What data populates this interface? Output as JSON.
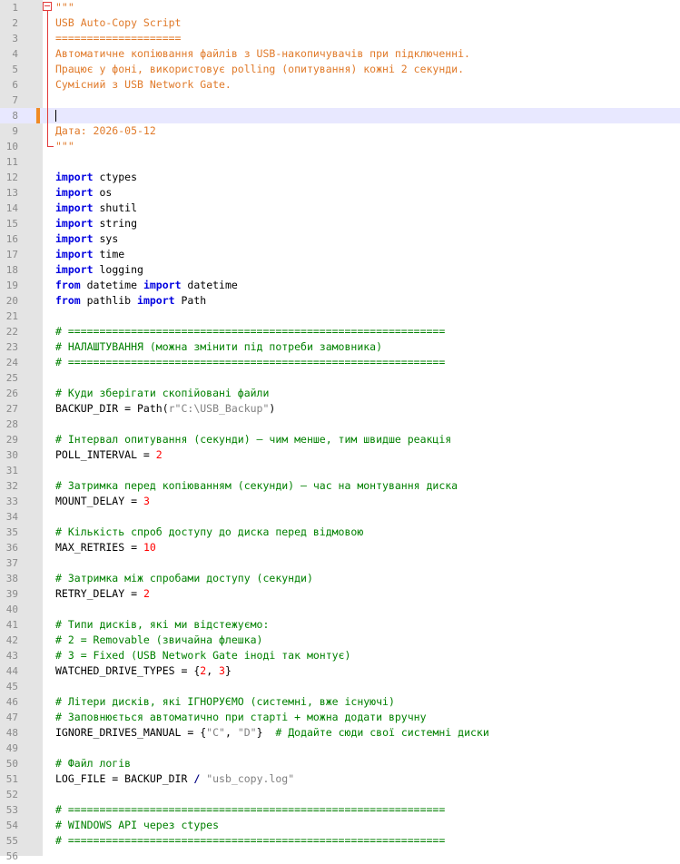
{
  "editor": {
    "current_line": 8,
    "changed_line": 8,
    "fold": {
      "start": 1,
      "end": 10
    },
    "colors": {
      "docstring": "#e07a2a",
      "keyword": "#0000e0",
      "comment": "#008000",
      "number": "#ff0000",
      "string": "#808080",
      "operator": "#000080",
      "gutter_bg": "#e4e4e4",
      "current_line_bg": "#e8e8ff",
      "fold_marker": "#e23a3a"
    },
    "lines": [
      {
        "n": "1",
        "tokens": [
          {
            "t": "\"\"\"",
            "c": "doc"
          }
        ]
      },
      {
        "n": "2",
        "tokens": [
          {
            "t": "USB Auto-Copy Script",
            "c": "doc"
          }
        ]
      },
      {
        "n": "3",
        "tokens": [
          {
            "t": "====================",
            "c": "doc"
          }
        ]
      },
      {
        "n": "4",
        "tokens": [
          {
            "t": "Автоматичне копіювання файлів з USB-накопичувачів при підключенні.",
            "c": "doc"
          }
        ]
      },
      {
        "n": "5",
        "tokens": [
          {
            "t": "Працює у фоні, використовує polling (опитування) кожні 2 секунди.",
            "c": "doc"
          }
        ]
      },
      {
        "n": "6",
        "tokens": [
          {
            "t": "Сумісний з USB Network Gate.",
            "c": "doc"
          }
        ]
      },
      {
        "n": "7",
        "tokens": []
      },
      {
        "n": "8",
        "tokens": []
      },
      {
        "n": "9",
        "tokens": [
          {
            "t": "Дата: 2026-05-12",
            "c": "doc"
          }
        ]
      },
      {
        "n": "10",
        "tokens": [
          {
            "t": "\"\"\"",
            "c": "doc"
          }
        ]
      },
      {
        "n": "11",
        "tokens": []
      },
      {
        "n": "12",
        "tokens": [
          {
            "t": "import",
            "c": "kw"
          },
          {
            "t": " ctypes",
            "c": "plain"
          }
        ]
      },
      {
        "n": "13",
        "tokens": [
          {
            "t": "import",
            "c": "kw"
          },
          {
            "t": " os",
            "c": "plain"
          }
        ]
      },
      {
        "n": "14",
        "tokens": [
          {
            "t": "import",
            "c": "kw"
          },
          {
            "t": " shutil",
            "c": "plain"
          }
        ]
      },
      {
        "n": "15",
        "tokens": [
          {
            "t": "import",
            "c": "kw"
          },
          {
            "t": " string",
            "c": "plain"
          }
        ]
      },
      {
        "n": "16",
        "tokens": [
          {
            "t": "import",
            "c": "kw"
          },
          {
            "t": " sys",
            "c": "plain"
          }
        ]
      },
      {
        "n": "17",
        "tokens": [
          {
            "t": "import",
            "c": "kw"
          },
          {
            "t": " time",
            "c": "plain"
          }
        ]
      },
      {
        "n": "18",
        "tokens": [
          {
            "t": "import",
            "c": "kw"
          },
          {
            "t": " logging",
            "c": "plain"
          }
        ]
      },
      {
        "n": "19",
        "tokens": [
          {
            "t": "from",
            "c": "kw"
          },
          {
            "t": " datetime ",
            "c": "plain"
          },
          {
            "t": "import",
            "c": "kw"
          },
          {
            "t": " datetime",
            "c": "plain"
          }
        ]
      },
      {
        "n": "20",
        "tokens": [
          {
            "t": "from",
            "c": "kw"
          },
          {
            "t": " pathlib ",
            "c": "plain"
          },
          {
            "t": "import",
            "c": "kw"
          },
          {
            "t": " Path",
            "c": "plain"
          }
        ]
      },
      {
        "n": "21",
        "tokens": []
      },
      {
        "n": "22",
        "tokens": [
          {
            "t": "# ============================================================",
            "c": "com"
          }
        ]
      },
      {
        "n": "23",
        "tokens": [
          {
            "t": "# НАЛАШТУВАННЯ (можна змінити під потреби замовника)",
            "c": "com"
          }
        ]
      },
      {
        "n": "24",
        "tokens": [
          {
            "t": "# ============================================================",
            "c": "com"
          }
        ]
      },
      {
        "n": "25",
        "tokens": []
      },
      {
        "n": "26",
        "tokens": [
          {
            "t": "# Куди зберігати скопійовані файли",
            "c": "com"
          }
        ]
      },
      {
        "n": "27",
        "tokens": [
          {
            "t": "BACKUP_DIR = Path(",
            "c": "plain"
          },
          {
            "t": "r\"C:\\USB_Backup\"",
            "c": "str"
          },
          {
            "t": ")",
            "c": "plain"
          }
        ]
      },
      {
        "n": "28",
        "tokens": []
      },
      {
        "n": "29",
        "tokens": [
          {
            "t": "# Інтервал опитування (секунди) — чим менше, тим швидше реакція",
            "c": "com"
          }
        ]
      },
      {
        "n": "30",
        "tokens": [
          {
            "t": "POLL_INTERVAL = ",
            "c": "plain"
          },
          {
            "t": "2",
            "c": "num"
          }
        ]
      },
      {
        "n": "31",
        "tokens": []
      },
      {
        "n": "32",
        "tokens": [
          {
            "t": "# Затримка перед копіюванням (секунди) — час на монтування диска",
            "c": "com"
          }
        ]
      },
      {
        "n": "33",
        "tokens": [
          {
            "t": "MOUNT_DELAY = ",
            "c": "plain"
          },
          {
            "t": "3",
            "c": "num"
          }
        ]
      },
      {
        "n": "34",
        "tokens": []
      },
      {
        "n": "35",
        "tokens": [
          {
            "t": "# Кількість спроб доступу до диска перед відмовою",
            "c": "com"
          }
        ]
      },
      {
        "n": "36",
        "tokens": [
          {
            "t": "MAX_RETRIES = ",
            "c": "plain"
          },
          {
            "t": "10",
            "c": "num"
          }
        ]
      },
      {
        "n": "37",
        "tokens": []
      },
      {
        "n": "38",
        "tokens": [
          {
            "t": "# Затримка між спробами доступу (секунди)",
            "c": "com"
          }
        ]
      },
      {
        "n": "39",
        "tokens": [
          {
            "t": "RETRY_DELAY = ",
            "c": "plain"
          },
          {
            "t": "2",
            "c": "num"
          }
        ]
      },
      {
        "n": "40",
        "tokens": []
      },
      {
        "n": "41",
        "tokens": [
          {
            "t": "# Типи дисків, які ми відстежуємо:",
            "c": "com"
          }
        ]
      },
      {
        "n": "42",
        "tokens": [
          {
            "t": "# 2 = Removable (звичайна флешка)",
            "c": "com"
          }
        ]
      },
      {
        "n": "43",
        "tokens": [
          {
            "t": "# 3 = Fixed (USB Network Gate іноді так монтує)",
            "c": "com"
          }
        ]
      },
      {
        "n": "44",
        "tokens": [
          {
            "t": "WATCHED_DRIVE_TYPES = {",
            "c": "plain"
          },
          {
            "t": "2",
            "c": "num"
          },
          {
            "t": ", ",
            "c": "plain"
          },
          {
            "t": "3",
            "c": "num"
          },
          {
            "t": "}",
            "c": "plain"
          }
        ]
      },
      {
        "n": "45",
        "tokens": []
      },
      {
        "n": "46",
        "tokens": [
          {
            "t": "# Літери дисків, які ІГНОРУЄМО (системні, вже існуючі)",
            "c": "com"
          }
        ]
      },
      {
        "n": "47",
        "tokens": [
          {
            "t": "# Заповнюється автоматично при старті + можна додати вручну",
            "c": "com"
          }
        ]
      },
      {
        "n": "48",
        "tokens": [
          {
            "t": "IGNORE_DRIVES_MANUAL = {",
            "c": "plain"
          },
          {
            "t": "\"C\"",
            "c": "str"
          },
          {
            "t": ", ",
            "c": "plain"
          },
          {
            "t": "\"D\"",
            "c": "str"
          },
          {
            "t": "}  ",
            "c": "plain"
          },
          {
            "t": "# Додайте сюди свої системні диски",
            "c": "com"
          }
        ]
      },
      {
        "n": "49",
        "tokens": []
      },
      {
        "n": "50",
        "tokens": [
          {
            "t": "# Файл логів",
            "c": "com"
          }
        ]
      },
      {
        "n": "51",
        "tokens": [
          {
            "t": "LOG_FILE = BACKUP_DIR ",
            "c": "plain"
          },
          {
            "t": "/",
            "c": "op"
          },
          {
            "t": " ",
            "c": "plain"
          },
          {
            "t": "\"usb_copy.log\"",
            "c": "str"
          }
        ]
      },
      {
        "n": "52",
        "tokens": []
      },
      {
        "n": "53",
        "tokens": [
          {
            "t": "# ============================================================",
            "c": "com"
          }
        ]
      },
      {
        "n": "54",
        "tokens": [
          {
            "t": "# WINDOWS API через ctypes",
            "c": "com"
          }
        ]
      },
      {
        "n": "55",
        "tokens": [
          {
            "t": "# ============================================================",
            "c": "com"
          }
        ]
      },
      {
        "n": "56",
        "tokens": []
      }
    ]
  }
}
